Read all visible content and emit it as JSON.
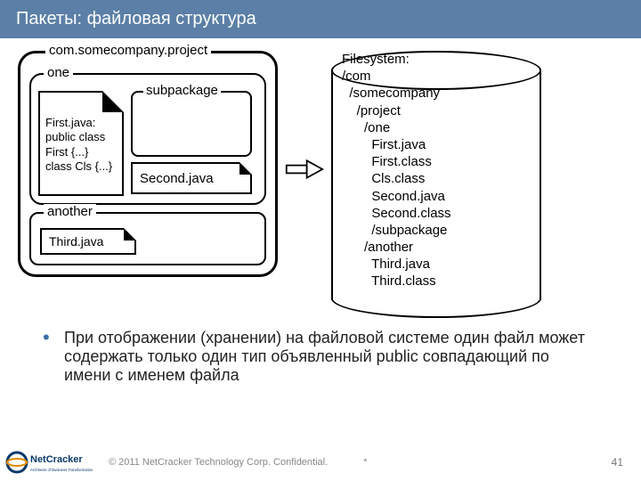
{
  "header": {
    "title": "Пакеты: файловая структура"
  },
  "pkg": {
    "rootLabel": "com.somecompany.project",
    "one": {
      "label": "one",
      "subpackageLabel": "subpackage",
      "firstFile": "First.java:\npublic class\nFirst {...}\nclass Cls {...}",
      "secondFile": "Second.java"
    },
    "another": {
      "label": "another",
      "thirdFile": "Third.java"
    }
  },
  "filesystem": "Filesystem:\n/com\n  /somecompany\n    /project\n      /one\n        First.java\n        First.class\n        Cls.class\n        Second.java\n        Second.class\n        /subpackage\n      /another\n        Third.java\n        Third.class",
  "bullet": "При отображении (хранении) на файловой системе один файл может содержать только один тип объявленный public совпадающий по имени с именем файла",
  "footer": {
    "brandTop": "NetCracker",
    "brandTag": "Architects of Business Transformation",
    "copyright": "© 2011 NetCracker Technology Corp. Confidential.",
    "asterisk": "*",
    "pageNumber": "41"
  }
}
